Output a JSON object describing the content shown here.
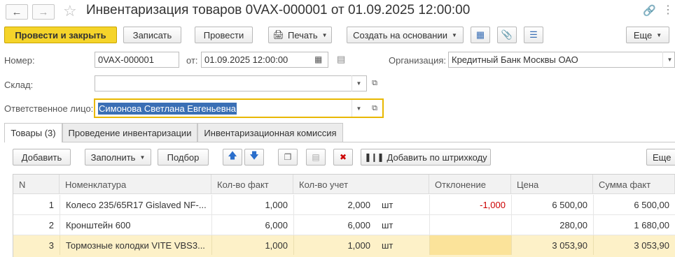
{
  "window": {
    "title": "Инвентаризация товаров 0VAX-000001 от 01.09.2025 12:00:00"
  },
  "toolbar": {
    "post_close": "Провести и закрыть",
    "write": "Записать",
    "post": "Провести",
    "print": "Печать",
    "create_based": "Создать на основании",
    "more": "Еще"
  },
  "form": {
    "number_label": "Номер:",
    "number_value": "0VAX-000001",
    "date_label": "от:",
    "date_value": "01.09.2025 12:00:00",
    "org_label": "Организация:",
    "org_value": "Кредитный Банк Москвы ОАО",
    "warehouse_label": "Склад:",
    "warehouse_value": "",
    "responsible_label": "Ответственное лицо:",
    "responsible_value": "Симонова Светлана Евгеньевна"
  },
  "tabs": [
    {
      "label": "Товары (3)"
    },
    {
      "label": "Проведение инвентаризации"
    },
    {
      "label": "Инвентаризационная комиссия"
    }
  ],
  "table_toolbar": {
    "add": "Добавить",
    "fill": "Заполнить",
    "pick": "Подбор",
    "barcode": "Добавить по штрихкоду",
    "more": "Еще"
  },
  "table": {
    "columns": [
      "N",
      "Номенклатура",
      "Кол-во факт",
      "Кол-во учет",
      "Отклонение",
      "Цена",
      "Сумма факт"
    ],
    "rows": [
      {
        "n": "1",
        "name": "Колесо 235/65R17 Gislaved NF-...",
        "qty_fact": "1,000",
        "qty_acc": "2,000",
        "unit": "шт",
        "deviation": "-1,000",
        "price": "6 500,00",
        "sum": "6 500,00"
      },
      {
        "n": "2",
        "name": "Кронштейн 600",
        "qty_fact": "6,000",
        "qty_acc": "6,000",
        "unit": "шт",
        "deviation": "",
        "price": "280,00",
        "sum": "1 680,00"
      },
      {
        "n": "3",
        "name": "Тормозные колодки VITE VBS3...",
        "qty_fact": "1,000",
        "qty_acc": "1,000",
        "unit": "шт",
        "deviation": "",
        "price": "3 053,90",
        "sum": "3 053,90"
      }
    ]
  },
  "colors": {
    "primary_button": "#f5d42a",
    "selected_row": "#fdf1c8",
    "selected_cell": "#fbe39a",
    "negative": "#cc0000",
    "focus_border": "#e8b800"
  }
}
